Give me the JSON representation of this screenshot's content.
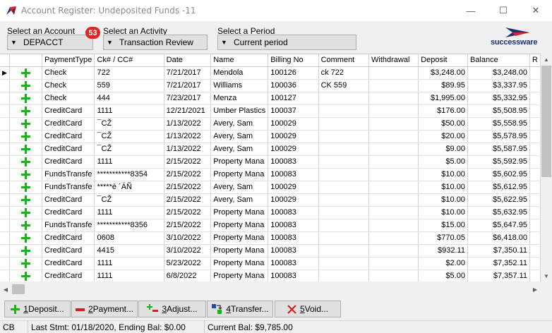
{
  "window": {
    "title": "Account Register: Undeposited Funds -11",
    "minimize": "—",
    "maximize": "☐",
    "close": "✕"
  },
  "selectors": {
    "account": {
      "label": "Select an Account",
      "value": "DEPACCT"
    },
    "activity": {
      "label": "Select an Activity",
      "value": "Transaction Review"
    },
    "period": {
      "label": "Select a Period",
      "value": "Current period"
    },
    "badge": "53"
  },
  "logo": {
    "text": "successware"
  },
  "grid": {
    "columns": [
      "",
      "",
      "PaymentType",
      "Ck# / CC#",
      "Date",
      "Name",
      "Billing No",
      "Comment",
      "Withdrawal",
      "Deposit",
      "Balance",
      "R"
    ],
    "rows": [
      {
        "indicator": "▶",
        "type": "Check",
        "ck": "722",
        "date": "7/21/2017",
        "name": "Mendola",
        "billing": "100126",
        "comment": "ck 722",
        "withdrawal": "",
        "deposit": "$3,248.00",
        "balance": "$3,248.00"
      },
      {
        "indicator": "",
        "type": "Check",
        "ck": "559",
        "date": "7/21/2017",
        "name": "Williams",
        "billing": "100036",
        "comment": "CK 559",
        "withdrawal": "",
        "deposit": "$89.95",
        "balance": "$3,337.95"
      },
      {
        "indicator": "",
        "type": "Check",
        "ck": "444",
        "date": "7/23/2017",
        "name": "Menza",
        "billing": "100127",
        "comment": "",
        "withdrawal": "",
        "deposit": "$1,995.00",
        "balance": "$5,332.95"
      },
      {
        "indicator": "",
        "type": "CreditCard",
        "ck": "1111",
        "date": "12/21/2021",
        "name": "Umber Plastics",
        "billing": "100037",
        "comment": "",
        "withdrawal": "",
        "deposit": "$176.00",
        "balance": "$5,508.95"
      },
      {
        "indicator": "",
        "type": "CreditCard",
        "ck": "¯CŽ",
        "date": "1/13/2022",
        "name": "Avery, Sam",
        "billing": "100029",
        "comment": "",
        "withdrawal": "",
        "deposit": "$50.00",
        "balance": "$5,558.95"
      },
      {
        "indicator": "",
        "type": "CreditCard",
        "ck": "¯CŽ",
        "date": "1/13/2022",
        "name": "Avery, Sam",
        "billing": "100029",
        "comment": "",
        "withdrawal": "",
        "deposit": "$20.00",
        "balance": "$5,578.95"
      },
      {
        "indicator": "",
        "type": "CreditCard",
        "ck": "¯CŽ",
        "date": "1/13/2022",
        "name": "Avery, Sam",
        "billing": "100029",
        "comment": "",
        "withdrawal": "",
        "deposit": "$9.00",
        "balance": "$5,587.95"
      },
      {
        "indicator": "",
        "type": "CreditCard",
        "ck": "1111",
        "date": "2/15/2022",
        "name": "Property Mana",
        "billing": "100083",
        "comment": "",
        "withdrawal": "",
        "deposit": "$5.00",
        "balance": "$5,592.95"
      },
      {
        "indicator": "",
        "type": "FundsTransfe",
        "ck": "***********8354",
        "date": "2/15/2022",
        "name": "Property Mana",
        "billing": "100083",
        "comment": "",
        "withdrawal": "",
        "deposit": "$10.00",
        "balance": "$5,602.95"
      },
      {
        "indicator": "",
        "type": "FundsTransfe",
        "ck": "*****è ´ÄÑ",
        "date": "2/15/2022",
        "name": "Avery, Sam",
        "billing": "100029",
        "comment": "",
        "withdrawal": "",
        "deposit": "$10.00",
        "balance": "$5,612.95"
      },
      {
        "indicator": "",
        "type": "CreditCard",
        "ck": "¯CŽ",
        "date": "2/15/2022",
        "name": "Avery, Sam",
        "billing": "100029",
        "comment": "",
        "withdrawal": "",
        "deposit": "$10.00",
        "balance": "$5,622.95"
      },
      {
        "indicator": "",
        "type": "CreditCard",
        "ck": "1111",
        "date": "2/15/2022",
        "name": "Property Mana",
        "billing": "100083",
        "comment": "",
        "withdrawal": "",
        "deposit": "$10.00",
        "balance": "$5,632.95"
      },
      {
        "indicator": "",
        "type": "FundsTransfe",
        "ck": "***********8356",
        "date": "2/15/2022",
        "name": "Property Mana",
        "billing": "100083",
        "comment": "",
        "withdrawal": "",
        "deposit": "$15.00",
        "balance": "$5,647.95"
      },
      {
        "indicator": "",
        "type": "CreditCard",
        "ck": "0608",
        "date": "3/10/2022",
        "name": "Property Mana",
        "billing": "100083",
        "comment": "",
        "withdrawal": "",
        "deposit": "$770.05",
        "balance": "$6,418.00"
      },
      {
        "indicator": "",
        "type": "CreditCard",
        "ck": "4415",
        "date": "3/10/2022",
        "name": "Property Mana",
        "billing": "100083",
        "comment": "",
        "withdrawal": "",
        "deposit": "$932.11",
        "balance": "$7,350.11"
      },
      {
        "indicator": "",
        "type": "CreditCard",
        "ck": "1111",
        "date": "5/23/2022",
        "name": "Property Mana",
        "billing": "100083",
        "comment": "",
        "withdrawal": "",
        "deposit": "$2.00",
        "balance": "$7,352.11"
      },
      {
        "indicator": "",
        "type": "CreditCard",
        "ck": "1111",
        "date": "6/8/2022",
        "name": "Property Mana",
        "billing": "100083",
        "comment": "",
        "withdrawal": "",
        "deposit": "$5.00",
        "balance": "$7,357.11"
      }
    ]
  },
  "actions": [
    {
      "num": "1",
      "label": " Deposit...",
      "icon": "plus-icon"
    },
    {
      "num": "2",
      "label": " Payment...",
      "icon": "minus-icon"
    },
    {
      "num": "3",
      "label": " Adjust...",
      "icon": "adjust-icon"
    },
    {
      "num": "4",
      "label": " Transfer...",
      "icon": "transfer-icon"
    },
    {
      "num": "5",
      "label": " Void...",
      "icon": "void-icon"
    }
  ],
  "status": {
    "code": "CB",
    "last_stmt": "Last Stmt: 01/18/2020,  Ending Bal: $0.00",
    "current_bal": "Current Bal: $9,785.00"
  },
  "colors": {
    "plus": "#18b418",
    "badge": "#e62121",
    "logo_blue": "#1e2f6e",
    "logo_red": "#d8262c"
  }
}
